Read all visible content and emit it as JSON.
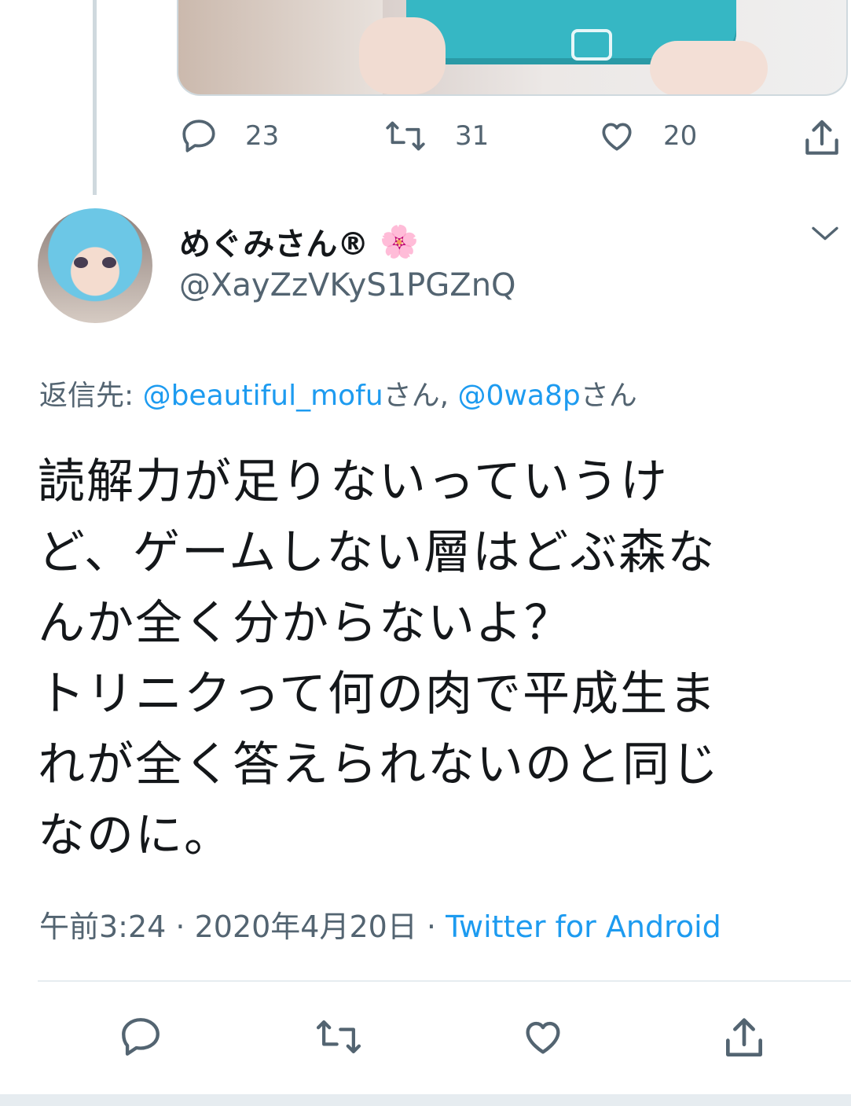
{
  "previous_tweet": {
    "stats": {
      "replies": "23",
      "retweets": "31",
      "likes": "20"
    }
  },
  "tweet": {
    "display_name": "めぐみさん®",
    "name_emoji": "🌸",
    "handle": "@XayZzVKyS1PGZnQ",
    "reply_prefix": "返信先: ",
    "reply_user1": "@beautiful_mofu",
    "reply_san1": "さん, ",
    "reply_user2": "@0wa8p",
    "reply_san2": "さん",
    "text": "読解力が足りないっていうけ\nど、ゲームしない層はどぶ森な\nんか全く分からないよ？\nトリニクって何の肉で平成生ま\nれが全く答えられないのと同じ\nなのに。",
    "time": "午前3:24",
    "date": "2020年4月20日",
    "separator": " · ",
    "client": "Twitter for Android"
  },
  "icons": {
    "reply": "reply-icon",
    "retweet": "retweet-icon",
    "like": "heart-icon",
    "share": "share-icon",
    "more": "chevron-down-icon"
  },
  "colors": {
    "link": "#1d9bf0",
    "secondary": "#536471",
    "thread_line": "#cfd9de"
  }
}
